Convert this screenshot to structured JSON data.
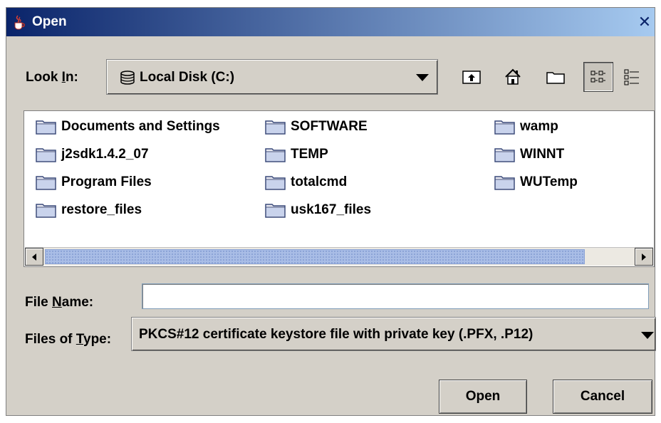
{
  "window": {
    "title": "Open",
    "close_glyph": "✕"
  },
  "look_in": {
    "label_prefix": "Look ",
    "label_mnemonic": "I",
    "label_suffix": "n:",
    "value": "Local Disk (C:)",
    "icon": "disk-icon"
  },
  "toolbar": {
    "buttons": [
      {
        "name": "up-folder-icon"
      },
      {
        "name": "home-icon"
      },
      {
        "name": "new-folder-icon"
      },
      {
        "name": "list-view-icon",
        "pressed": true
      },
      {
        "name": "details-view-icon"
      }
    ]
  },
  "files": [
    {
      "name": "Documents and Settings"
    },
    {
      "name": "j2sdk1.4.2_07"
    },
    {
      "name": "Program Files"
    },
    {
      "name": "restore_files"
    },
    {
      "name": "SOFTWARE"
    },
    {
      "name": "TEMP"
    },
    {
      "name": "totalcmd"
    },
    {
      "name": "usk167_files"
    },
    {
      "name": "wamp"
    },
    {
      "name": "WINNT"
    },
    {
      "name": "WUTemp"
    }
  ],
  "file_name": {
    "label_prefix": "File ",
    "label_mnemonic": "N",
    "label_suffix": "ame:",
    "value": ""
  },
  "file_type": {
    "label_prefix": "Files of ",
    "label_mnemonic": "T",
    "label_suffix": "ype:",
    "value": "PKCS#12 certificate keystore file with private key (.PFX, .P12)"
  },
  "buttons": {
    "open": "Open",
    "cancel": "Cancel"
  },
  "colors": {
    "title_gradient_start": "#0a246a",
    "title_gradient_end": "#a6caf0",
    "dialog_bg": "#d4d0c8",
    "scroll_thumb": "#a9bde6"
  }
}
